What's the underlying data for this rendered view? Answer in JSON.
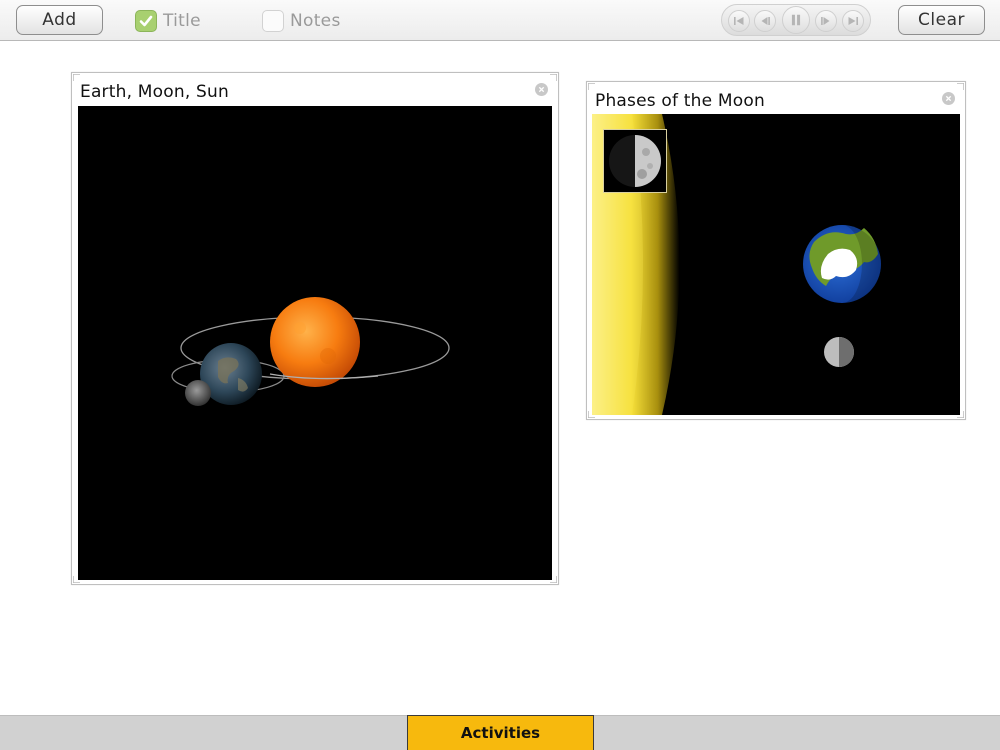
{
  "toolbar": {
    "add_label": "Add",
    "clear_label": "Clear",
    "title_check_label": "Title",
    "title_checked": true,
    "notes_check_label": "Notes",
    "notes_checked": false,
    "transport": [
      "skip-to-start-icon",
      "step-back-icon",
      "pause-icon",
      "step-forward-icon",
      "skip-to-end-icon"
    ]
  },
  "panels": [
    {
      "title": "Earth, Moon, Sun",
      "scene": "earth-moon-sun-orbit-view"
    },
    {
      "title": "Phases of the Moon",
      "scene": "moon-phases-view"
    }
  ],
  "bottom_bar": {
    "activities_label": "Activities"
  },
  "colors": {
    "accent": "#f7b90d",
    "check_green": "#a8d070",
    "view_background": "#000000"
  }
}
